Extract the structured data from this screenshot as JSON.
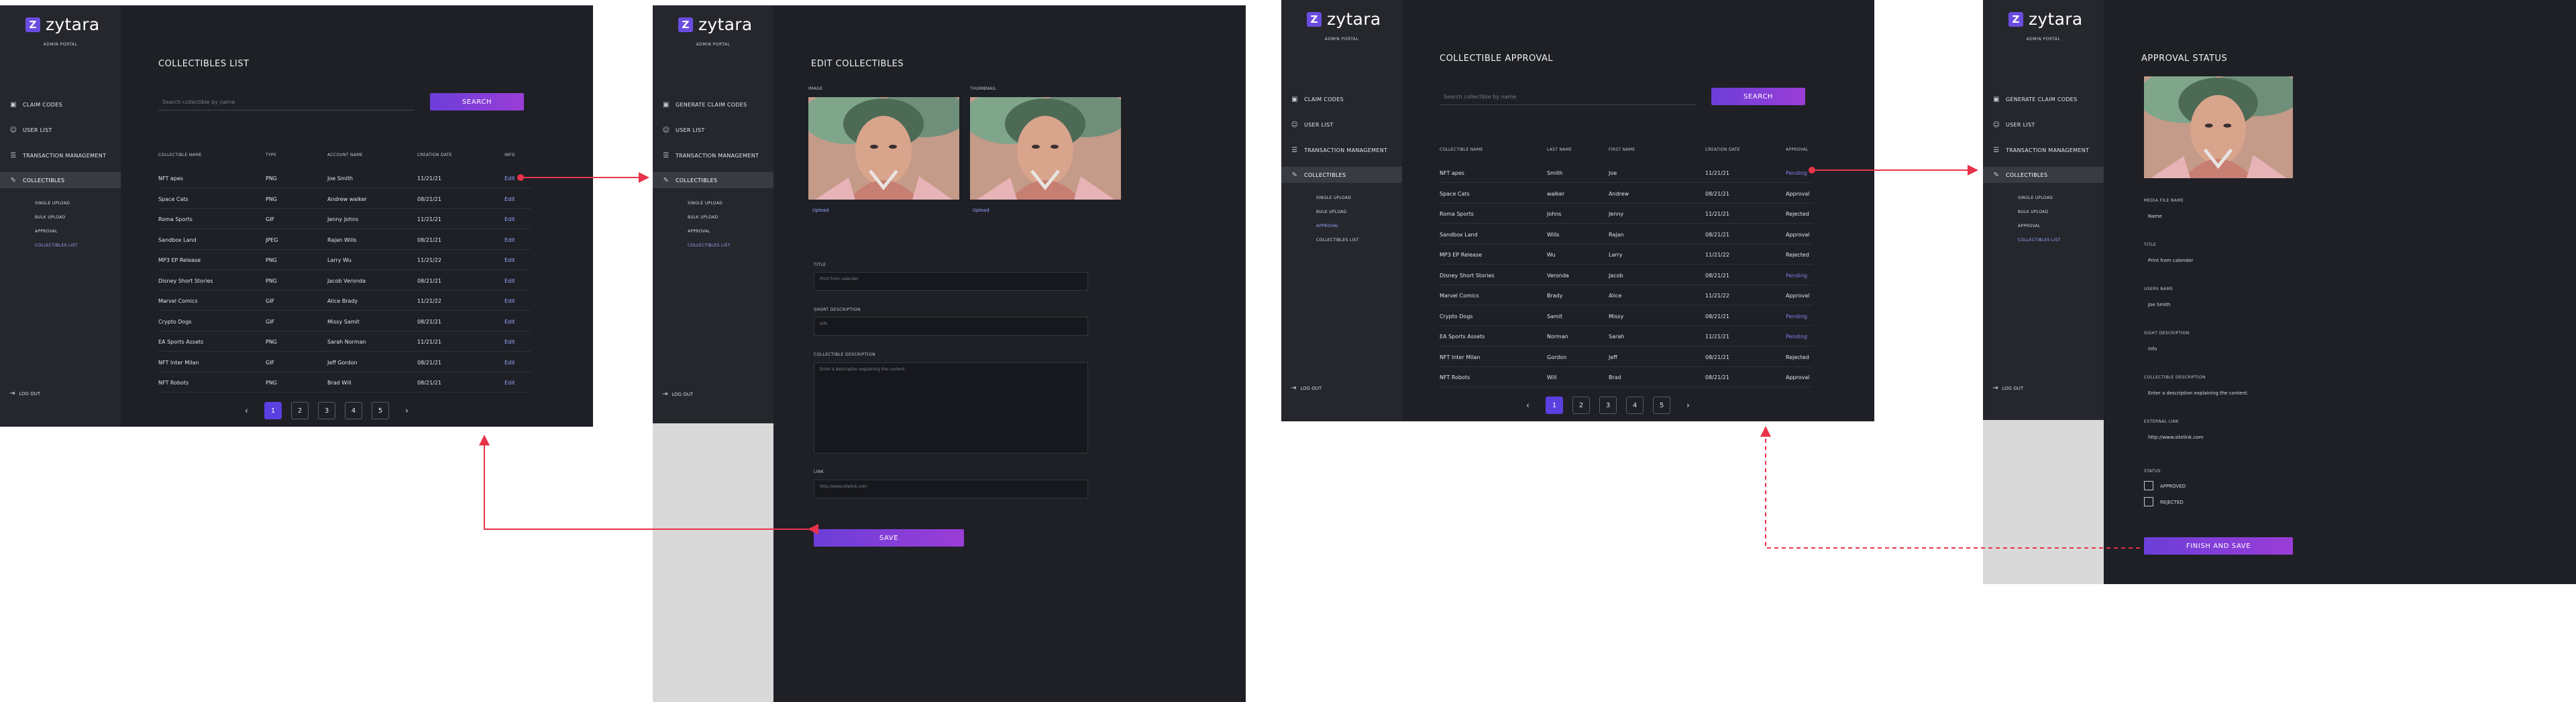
{
  "brand": {
    "logo_letter": "Z",
    "name": "zytara",
    "subtitle": "ADMIN PORTAL"
  },
  "colors": {
    "accent": "#5b3fe0",
    "link": "#9aa6ff",
    "background": "#1e2026",
    "sidebar": "#25272d",
    "annotation_arrow": "#e8334a"
  },
  "screen1": {
    "nav": [
      {
        "label": "CLAIM CODES",
        "icon": "clipboard-icon"
      },
      {
        "label": "USER LIST",
        "icon": "user-icon"
      },
      {
        "label": "TRANSACTION MANAGEMENT",
        "icon": "list-icon"
      },
      {
        "label": "COLLECTIBLES",
        "icon": "pencil-icon"
      }
    ],
    "subnav": [
      "SINGLE UPLOAD",
      "BULK UPLOAD",
      "APPROVAL",
      "COLLECTIBLES LIST"
    ],
    "logout": "LOG OUT",
    "title": "COLLECTIBLES LIST",
    "search_placeholder": "Search collectible by name",
    "search_button": "SEARCH",
    "headers": [
      "COLLECTIBLE NAME",
      "TYPE",
      "ACCOUNT NAME",
      "CREATION DATE",
      "INFO"
    ],
    "rows": [
      [
        "NFT apes",
        "PNG",
        "Joe Smith",
        "11/21/21",
        "Edit"
      ],
      [
        "Space Cats",
        "PNG",
        "Andrew walker",
        "08/21/21",
        "Edit"
      ],
      [
        "Roma Sports",
        "GIF",
        "Jenny Johns",
        "11/21/21",
        "Edit"
      ],
      [
        "Sandbox Land",
        "JPEG",
        "Rajan Wills",
        "08/21/21",
        "Edit"
      ],
      [
        "MP3 EP Release",
        "PNG",
        "Larry Wu",
        "11/21/22",
        "Edit"
      ],
      [
        "Disney Short Stories",
        "PNG",
        "Jacob Veronda",
        "08/21/21",
        "Edit"
      ],
      [
        "Marvel Comics",
        "GIF",
        "Alice Brady",
        "11/21/22",
        "Edit"
      ],
      [
        "Crypto Dogs",
        "GIF",
        "Missy Samit",
        "08/21/21",
        "Edit"
      ],
      [
        "EA Sports Assets",
        "PNG",
        "Sarah Norman",
        "11/21/21",
        "Edit"
      ],
      [
        "NFT Inter Milan",
        "GIF",
        "Jeff Gordon",
        "08/21/21",
        "Edit"
      ],
      [
        "NFT Robots",
        "PNG",
        "Brad Will",
        "08/21/21",
        "Edit"
      ]
    ],
    "pagination": {
      "prev": "‹",
      "next": "›",
      "pages": [
        "1",
        "2",
        "3",
        "4",
        "5"
      ],
      "current": "1"
    }
  },
  "screen2": {
    "nav": [
      {
        "label": "GENERATE CLAIM CODES",
        "icon": "clipboard-icon"
      },
      {
        "label": "USER LIST",
        "icon": "user-icon"
      },
      {
        "label": "TRANSACTION MANAGEMENT",
        "icon": "list-icon"
      },
      {
        "label": "COLLECTIBLES",
        "icon": "pencil-icon"
      }
    ],
    "subnav": [
      "SINGLE UPLOAD",
      "BULK UPLOAD",
      "APPROVAL",
      "COLLECTIBLES LIST"
    ],
    "logout": "LOG OUT",
    "title": "EDIT COLLECTIBLES",
    "image_label": "IMAGE",
    "thumbnail_label": "THUMBNAIL",
    "upload": "Upload",
    "fields": [
      {
        "label": "TITLE",
        "placeholder": "Print from calender"
      },
      {
        "label": "SHORT DESCRIPTION",
        "placeholder": "Info"
      },
      {
        "label": "COLLECTIBLE DESCRIPTION",
        "placeholder": "Enter a description explaining the content"
      },
      {
        "label": "LINK",
        "placeholder": "http://www.sitelink.com"
      }
    ],
    "save_button": "SAVE"
  },
  "screen3": {
    "nav": [
      {
        "label": "CLAIM CODES",
        "icon": "clipboard-icon"
      },
      {
        "label": "USER LIST",
        "icon": "user-icon"
      },
      {
        "label": "TRANSACTION MANAGEMENT",
        "icon": "list-icon"
      },
      {
        "label": "COLLECTIBLES",
        "icon": "pencil-icon"
      }
    ],
    "subnav": [
      "SINGLE UPLOAD",
      "BULK UPLOAD",
      "APPROVAL",
      "COLLECTIBLES LIST"
    ],
    "logout": "LOG OUT",
    "title": "COLLECTIBLE APPROVAL",
    "search_placeholder": "Search collectible by name",
    "search_button": "SEARCH",
    "headers": [
      "COLLECTIBLE NAME",
      "LAST NAME",
      "FIRST NAME",
      "CREATION DATE",
      "APPROVAL"
    ],
    "rows": [
      [
        "NFT apes",
        "Smith",
        "Joe",
        "11/21/21",
        "Pending"
      ],
      [
        "Space Cats",
        "walker",
        "Andrew",
        "08/21/21",
        "Approval"
      ],
      [
        "Roma Sports",
        "Johns",
        "Jenny",
        "11/21/21",
        "Rejected"
      ],
      [
        "Sandbox Land",
        "Wills",
        "Rajan",
        "08/21/21",
        "Approval"
      ],
      [
        "MP3 EP Release",
        "Wu",
        "Larry",
        "11/21/22",
        "Rejected"
      ],
      [
        "Disney Short Stories",
        "Veronda",
        "Jacob",
        "08/21/21",
        "Pending"
      ],
      [
        "Marvel Comics",
        "Brady",
        "Alice",
        "11/21/22",
        "Approval"
      ],
      [
        "Crypto Dogs",
        "Samit",
        "Missy",
        "08/21/21",
        "Pending"
      ],
      [
        "EA Sports Assets",
        "Norman",
        "Sarah",
        "11/21/21",
        "Pending"
      ],
      [
        "NFT Inter Milan",
        "Gordon",
        "Jeff",
        "08/21/21",
        "Rejected"
      ],
      [
        "NFT Robots",
        "Will",
        "Brad",
        "08/21/21",
        "Approval"
      ]
    ],
    "pagination": {
      "prev": "‹",
      "next": "›",
      "pages": [
        "1",
        "2",
        "3",
        "4",
        "5"
      ],
      "current": "1"
    }
  },
  "screen4": {
    "nav": [
      {
        "label": "GENERATE CLAIM CODES",
        "icon": "clipboard-icon"
      },
      {
        "label": "USER LIST",
        "icon": "user-icon"
      },
      {
        "label": "TRANSACTION MANAGEMENT",
        "icon": "list-icon"
      },
      {
        "label": "COLLECTIBLES",
        "icon": "pencil-icon"
      }
    ],
    "subnav": [
      "SINGLE UPLOAD",
      "BULK UPLOAD",
      "APPROVAL",
      "COLLECTIBLES LIST"
    ],
    "logout": "LOG OUT",
    "title": "APPROVAL STATUS",
    "details": [
      {
        "label": "MEDIA FILE NAME",
        "value": "Name"
      },
      {
        "label": "TITLE",
        "value": "Print from calender"
      },
      {
        "label": "USERS NAME",
        "value": "Joe Smith"
      },
      {
        "label": "SIGHT DESCRIPTION",
        "value": "Info"
      },
      {
        "label": "COLLECTIBLE DESCRIPTION",
        "value": "Enter a description explaining the content."
      },
      {
        "label": "EXTERNAL LINK",
        "value": "http://www.sitelink.com"
      }
    ],
    "status_label": "STATUS",
    "options": [
      "APPROVED",
      "REJECTED"
    ],
    "finish_button": "FINISH AND SAVE"
  }
}
